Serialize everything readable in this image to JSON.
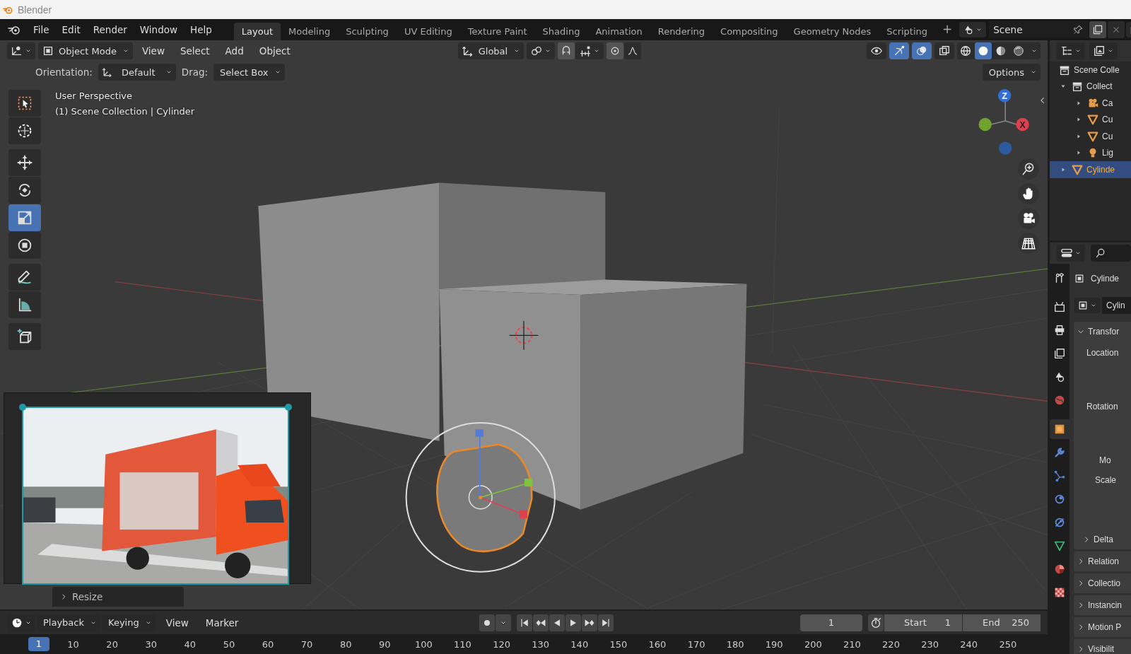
{
  "window": {
    "title": "Blender"
  },
  "menu": [
    "File",
    "Edit",
    "Render",
    "Window",
    "Help"
  ],
  "workspaces": [
    {
      "label": "Layout",
      "selected": true
    },
    {
      "label": "Modeling",
      "selected": false
    },
    {
      "label": "Sculpting",
      "selected": false
    },
    {
      "label": "UV Editing",
      "selected": false
    },
    {
      "label": "Texture Paint",
      "selected": false
    },
    {
      "label": "Shading",
      "selected": false
    },
    {
      "label": "Animation",
      "selected": false
    },
    {
      "label": "Rendering",
      "selected": false
    },
    {
      "label": "Compositing",
      "selected": false
    },
    {
      "label": "Geometry Nodes",
      "selected": false
    },
    {
      "label": "Scripting",
      "selected": false
    }
  ],
  "add_workspace": "+",
  "scene": {
    "value": "Scene"
  },
  "viewport_header": {
    "mode": "Object Mode",
    "menus": [
      "View",
      "Select",
      "Add",
      "Object"
    ],
    "transform_orientation": "Global",
    "toggles": [
      {
        "on": false
      },
      {
        "on": true
      },
      {
        "on": true
      },
      {
        "on": false
      }
    ],
    "shading": [
      {
        "selected": false
      },
      {
        "selected": true
      },
      {
        "selected": false
      },
      {
        "selected": false
      }
    ]
  },
  "tool_settings": {
    "orientation_label": "Orientation:",
    "orientation": "Default",
    "drag_label": "Drag:",
    "drag": "Select Box",
    "options": "Options"
  },
  "viewport": {
    "view_name": "User Perspective",
    "object_info": "(1) Scene Collection | Cylinder",
    "axes": [
      "Z",
      "X"
    ]
  },
  "toolbar": [
    {
      "selected": false
    },
    {
      "selected": false
    },
    {
      "selected": false
    },
    {
      "selected": false
    },
    {
      "selected": true
    },
    {
      "selected": false
    },
    {
      "selected": false
    },
    {
      "selected": false
    },
    {
      "selected": false
    }
  ],
  "image_overlay": {
    "kind": "picture"
  },
  "last_operator": {
    "label": "Resize",
    "expanded": false
  },
  "outliner": {
    "items": [
      {
        "label": "Scene Colle",
        "kind": "collection",
        "selected": false,
        "children": [
          {
            "label": "Collect",
            "kind": "collection",
            "expanded": true,
            "selected": false,
            "children": [
              {
                "label": "Ca",
                "kind": "camera",
                "expanded": false,
                "selected": false
              },
              {
                "label": "Cu",
                "kind": "mesh",
                "expanded": false,
                "selected": false
              },
              {
                "label": "Cu",
                "kind": "mesh",
                "expanded": false,
                "selected": false
              },
              {
                "label": "Lig",
                "kind": "light",
                "expanded": false,
                "selected": false
              }
            ]
          },
          {
            "label": "Cylinde",
            "kind": "mesh",
            "expanded": false,
            "selected": true
          }
        ]
      }
    ]
  },
  "properties": {
    "tabs": [
      {
        "selected": false
      },
      {
        "selected": false
      },
      {
        "selected": false
      },
      {
        "selected": false
      },
      {
        "selected": false
      },
      {
        "selected": false
      },
      {
        "selected": true
      },
      {
        "selected": false
      },
      {
        "selected": false
      },
      {
        "selected": false
      },
      {
        "selected": false
      },
      {
        "selected": false
      },
      {
        "selected": false
      },
      {
        "selected": false
      }
    ],
    "object_name": "Cylinde",
    "data_name": "Cylin",
    "panels": [
      {
        "label": "Transfor",
        "expanded": true,
        "fields": [
          "Location",
          "Rotation",
          "Mo",
          "Scale"
        ],
        "subpanels": [
          {
            "label": "Delta",
            "expanded": false
          }
        ]
      },
      {
        "label": "Relation",
        "expanded": false
      },
      {
        "label": "Collectio",
        "expanded": false
      },
      {
        "label": "Instancin",
        "expanded": false
      },
      {
        "label": "Motion P",
        "expanded": false
      },
      {
        "label": "Visibilit",
        "expanded": false
      }
    ]
  },
  "timeline": {
    "menus": [
      {
        "label": "Playback",
        "kind": "dropdown"
      },
      {
        "label": "Keying",
        "kind": "dropdown"
      },
      {
        "label": "View",
        "kind": "menu"
      },
      {
        "label": "Marker",
        "kind": "menu"
      }
    ],
    "current_frame": "1",
    "start_label": "Start",
    "start": "1",
    "end_label": "End",
    "end": "250",
    "ruler": [
      {
        "label": "1",
        "selected": true
      },
      {
        "label": "10",
        "selected": false
      },
      {
        "label": "20",
        "selected": false
      },
      {
        "label": "30",
        "selected": false
      },
      {
        "label": "40",
        "selected": false
      },
      {
        "label": "50",
        "selected": false
      },
      {
        "label": "60",
        "selected": false
      },
      {
        "label": "70",
        "selected": false
      },
      {
        "label": "80",
        "selected": false
      },
      {
        "label": "90",
        "selected": false
      },
      {
        "label": "100",
        "selected": false
      },
      {
        "label": "110",
        "selected": false
      },
      {
        "label": "120",
        "selected": false
      },
      {
        "label": "130",
        "selected": false
      },
      {
        "label": "140",
        "selected": false
      },
      {
        "label": "150",
        "selected": false
      },
      {
        "label": "160",
        "selected": false
      },
      {
        "label": "170",
        "selected": false
      },
      {
        "label": "180",
        "selected": false
      },
      {
        "label": "190",
        "selected": false
      },
      {
        "label": "200",
        "selected": false
      },
      {
        "label": "210",
        "selected": false
      },
      {
        "label": "220",
        "selected": false
      },
      {
        "label": "230",
        "selected": false
      },
      {
        "label": "240",
        "selected": false
      },
      {
        "label": "250",
        "selected": false
      }
    ]
  }
}
